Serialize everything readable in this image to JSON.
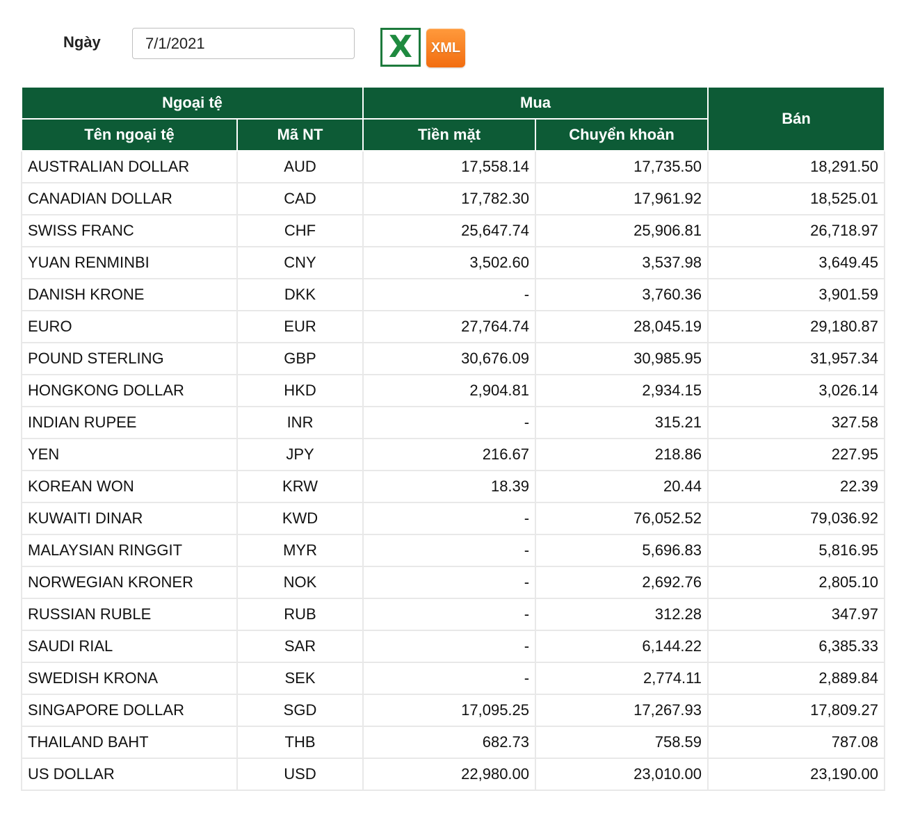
{
  "filter": {
    "date_label": "Ngày",
    "date_value": "7/1/2021",
    "excel_icon": "excel-icon",
    "xml_label": "XML"
  },
  "table": {
    "group_currency": "Ngoại tệ",
    "group_buy": "Mua",
    "col_sell": "Bán",
    "col_name": "Tên ngoại tệ",
    "col_code": "Mã NT",
    "col_cash": "Tiền mặt",
    "col_transfer": "Chuyển khoản",
    "rows": [
      {
        "name": "AUSTRALIAN DOLLAR",
        "code": "AUD",
        "cash": "17,558.14",
        "transfer": "17,735.50",
        "sell": "18,291.50"
      },
      {
        "name": "CANADIAN DOLLAR",
        "code": "CAD",
        "cash": "17,782.30",
        "transfer": "17,961.92",
        "sell": "18,525.01"
      },
      {
        "name": "SWISS FRANC",
        "code": "CHF",
        "cash": "25,647.74",
        "transfer": "25,906.81",
        "sell": "26,718.97"
      },
      {
        "name": "YUAN RENMINBI",
        "code": "CNY",
        "cash": "3,502.60",
        "transfer": "3,537.98",
        "sell": "3,649.45"
      },
      {
        "name": "DANISH KRONE",
        "code": "DKK",
        "cash": "-",
        "transfer": "3,760.36",
        "sell": "3,901.59"
      },
      {
        "name": "EURO",
        "code": "EUR",
        "cash": "27,764.74",
        "transfer": "28,045.19",
        "sell": "29,180.87"
      },
      {
        "name": "POUND STERLING",
        "code": "GBP",
        "cash": "30,676.09",
        "transfer": "30,985.95",
        "sell": "31,957.34"
      },
      {
        "name": "HONGKONG DOLLAR",
        "code": "HKD",
        "cash": "2,904.81",
        "transfer": "2,934.15",
        "sell": "3,026.14"
      },
      {
        "name": "INDIAN RUPEE",
        "code": "INR",
        "cash": "-",
        "transfer": "315.21",
        "sell": "327.58"
      },
      {
        "name": "YEN",
        "code": "JPY",
        "cash": "216.67",
        "transfer": "218.86",
        "sell": "227.95"
      },
      {
        "name": "KOREAN WON",
        "code": "KRW",
        "cash": "18.39",
        "transfer": "20.44",
        "sell": "22.39"
      },
      {
        "name": "KUWAITI DINAR",
        "code": "KWD",
        "cash": "-",
        "transfer": "76,052.52",
        "sell": "79,036.92"
      },
      {
        "name": "MALAYSIAN RINGGIT",
        "code": "MYR",
        "cash": "-",
        "transfer": "5,696.83",
        "sell": "5,816.95"
      },
      {
        "name": "NORWEGIAN KRONER",
        "code": "NOK",
        "cash": "-",
        "transfer": "2,692.76",
        "sell": "2,805.10"
      },
      {
        "name": "RUSSIAN RUBLE",
        "code": "RUB",
        "cash": "-",
        "transfer": "312.28",
        "sell": "347.97"
      },
      {
        "name": "SAUDI RIAL",
        "code": "SAR",
        "cash": "-",
        "transfer": "6,144.22",
        "sell": "6,385.33"
      },
      {
        "name": "SWEDISH KRONA",
        "code": "SEK",
        "cash": "-",
        "transfer": "2,774.11",
        "sell": "2,889.84"
      },
      {
        "name": "SINGAPORE DOLLAR",
        "code": "SGD",
        "cash": "17,095.25",
        "transfer": "17,267.93",
        "sell": "17,809.27"
      },
      {
        "name": "THAILAND BAHT",
        "code": "THB",
        "cash": "682.73",
        "transfer": "758.59",
        "sell": "787.08"
      },
      {
        "name": "US DOLLAR",
        "code": "USD",
        "cash": "22,980.00",
        "transfer": "23,010.00",
        "sell": "23,190.00"
      }
    ]
  },
  "colors": {
    "header_green": "#0d5b36",
    "excel_green": "#1f8a3f",
    "xml_orange": "#f26d10"
  }
}
